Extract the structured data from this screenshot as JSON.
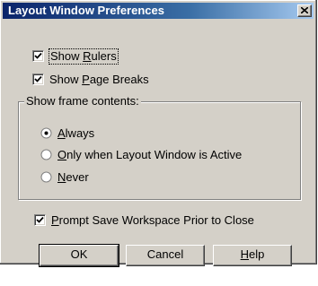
{
  "window": {
    "title": "Layout Window Preferences",
    "close_icon": "close-x-icon"
  },
  "options": {
    "show_rulers": {
      "checked": true,
      "pre": "Show ",
      "key": "R",
      "post": "ulers"
    },
    "show_page_breaks": {
      "checked": true,
      "pre": "Show ",
      "key": "P",
      "post": "age Breaks"
    }
  },
  "frame_group": {
    "legend": "Show frame contents:",
    "selected": "always",
    "choices": {
      "always": {
        "pre": "",
        "key": "A",
        "post": "lways"
      },
      "active": {
        "pre": "",
        "key": "O",
        "post": "nly when Layout Window is Active"
      },
      "never": {
        "pre": "",
        "key": "N",
        "post": "ever"
      }
    }
  },
  "prompt_save": {
    "checked": true,
    "pre": "",
    "key": "P",
    "post": "rompt Save Workspace Prior to Close"
  },
  "buttons": {
    "ok": "OK",
    "cancel": "Cancel",
    "help": {
      "pre": "",
      "key": "H",
      "post": "elp"
    }
  }
}
